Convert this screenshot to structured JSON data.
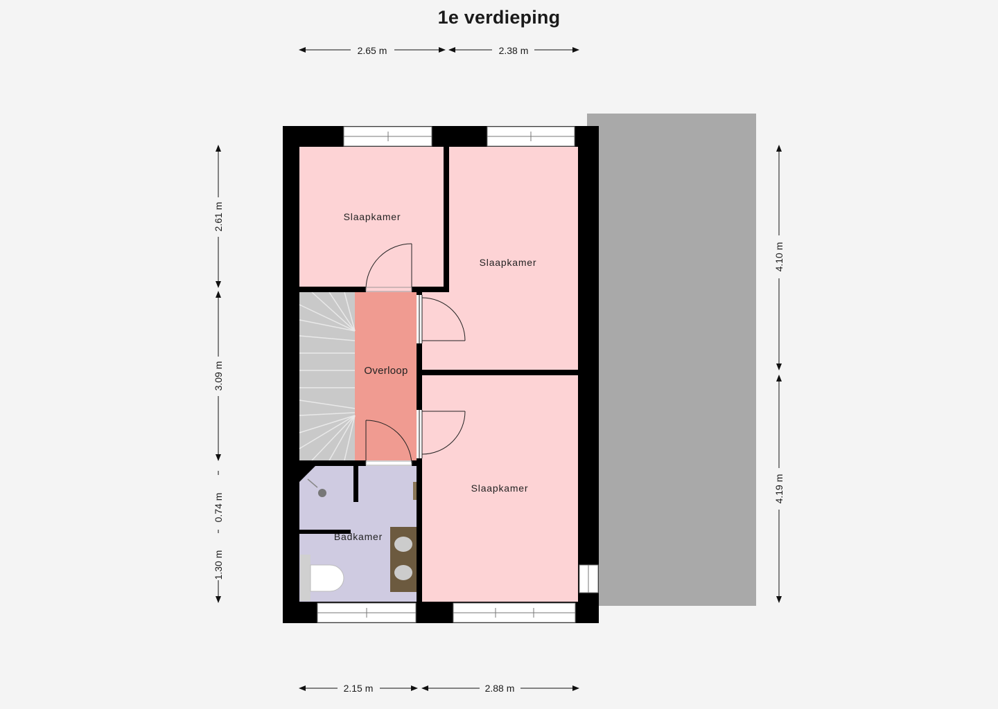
{
  "title": "1e verdieping",
  "rooms": {
    "bedroom_top_left": "Slaapkamer",
    "bedroom_top_right": "Slaapkamer",
    "bedroom_bottom_right": "Slaapkamer",
    "landing": "Overloop",
    "bathroom": "Badkamer"
  },
  "dimensions": {
    "top_left": "2.65 m",
    "top_right": "2.38 m",
    "bottom_left": "2.15 m",
    "bottom_right": "2.88 m",
    "left_upper": "2.61 m",
    "left_middle": "3.09 m",
    "left_small": "0.74 m",
    "left_lower": "1.30 m",
    "right_upper": "4.10 m",
    "right_lower": "4.19 m"
  },
  "colors": {
    "bedroom": "#fdd3d5",
    "landing": "#f09b91",
    "bathroom": "#cfcbe1",
    "wall": "#000000",
    "roof": "#a9a9a9",
    "stairs": "#c9c9c9"
  }
}
